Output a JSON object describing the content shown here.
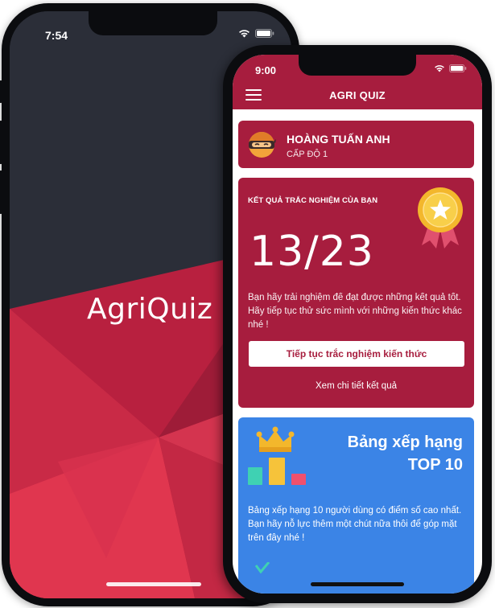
{
  "splash_phone": {
    "status_time": "7:54",
    "splash_title": "AgriQuiz"
  },
  "app_phone": {
    "status_time": "9:00",
    "header": {
      "title": "AGRI QUIZ",
      "menu_icon": "hamburger-menu-icon"
    },
    "user": {
      "name": "HOÀNG TUẤN ANH",
      "level": "CẤP ĐỘ 1",
      "avatar_icon": "ninja-avatar-icon"
    },
    "result": {
      "label": "KẾT QUẢ TRẮC NGHIỆM CỦA BẠN",
      "score": "13/23",
      "message": "Bạn hãy trải nghiệm để đạt được những kết quả tốt. Hãy tiếp tục thử sức mình với những kiến thức khác nhé !",
      "continue_button": "Tiếp tục trắc nghiệm kiến thức",
      "detail_link": "Xem chi tiết kết quả",
      "medal_icon": "star-medal-icon"
    },
    "ranking": {
      "title": "Bảng xếp hạng",
      "subtitle": "TOP 10",
      "description": "Bảng xếp hạng 10 người dùng có điểm số cao nhất. Bạn hãy nỗ lực thêm một chút nữa thôi để góp mặt trên đây nhé !",
      "trophy_icon": "crown-podium-icon"
    }
  },
  "colors": {
    "brand_red": "#a71d3e",
    "rank_blue": "#3b84e6",
    "splash_dark": "#2b2e38"
  }
}
